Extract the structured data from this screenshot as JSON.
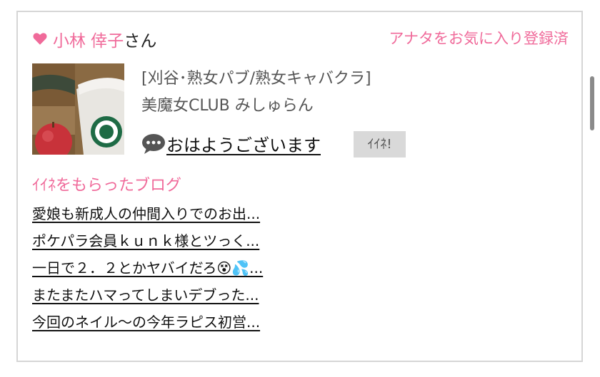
{
  "user": {
    "name": "小林 倖子",
    "suffix": "さん",
    "favorite_status": "アナタをお気に入り登録済"
  },
  "shop": {
    "category": "[刈谷･熟女パブ/熟女キャバクラ]",
    "name": "美魔女CLUB みしゅらん"
  },
  "post": {
    "text": "おはようございます",
    "iine_label": "ｲｲﾈ!"
  },
  "blog_section": {
    "title": "ｲｲﾈをもらったブログ",
    "items": [
      "愛娘も新成人の仲間入りでのお出...",
      "ポケパラ会員ｋｕｎｋ様とツっく...",
      "一日で２．２とかヤバイだろ😵💦...",
      "またまたハマってしまいデブった...",
      "今回のネイル〜の今年ラピス初営..."
    ]
  },
  "colors": {
    "accent_pink": "#f06a9a",
    "button_gray": "#d9d9d9",
    "border": "#d6d6d6"
  },
  "icons": [
    "heart-icon",
    "speech-bubble-icon"
  ]
}
